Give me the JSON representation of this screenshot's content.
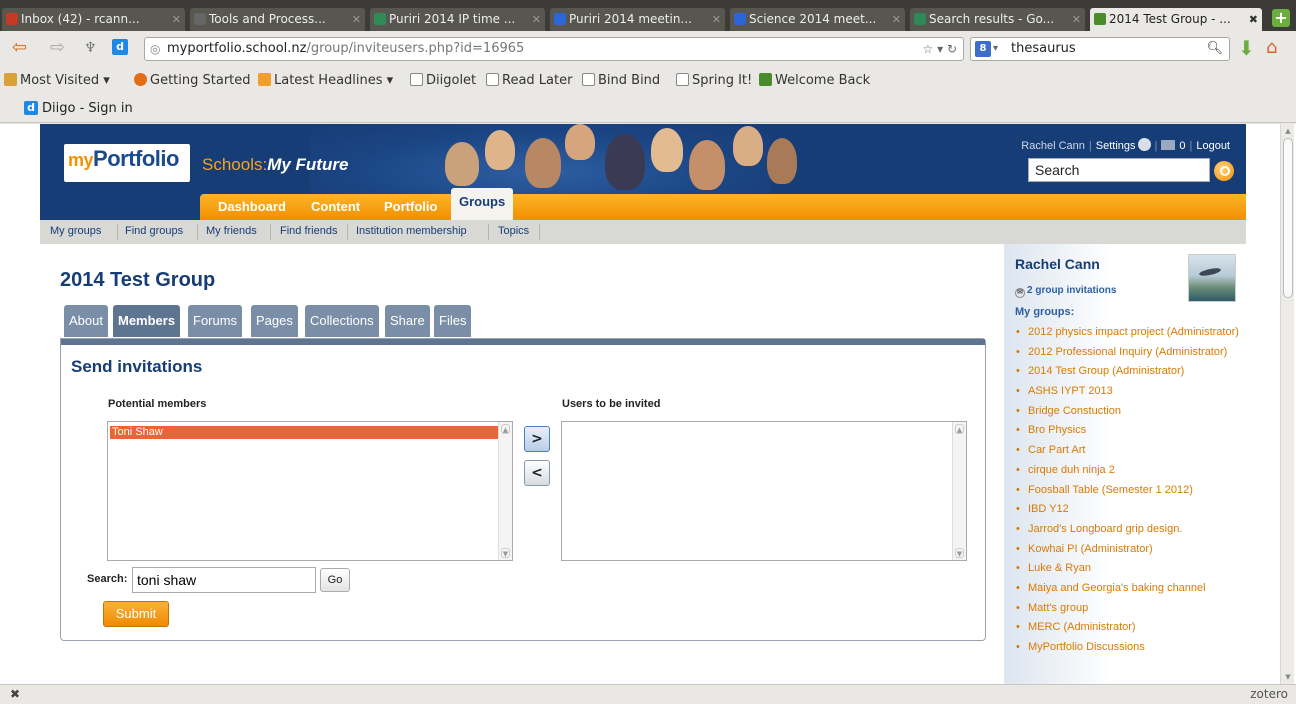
{
  "browser": {
    "tabs": [
      {
        "label": "Inbox (42) - rcann...",
        "color": "#c23b22"
      },
      {
        "label": "Tools and Process...",
        "color": "#666666"
      },
      {
        "label": "Puriri 2014 IP time ...",
        "color": "#2e8b57"
      },
      {
        "label": "Puriri 2014 meetin...",
        "color": "#2a66d9"
      },
      {
        "label": "Science 2014 meet...",
        "color": "#2a66d9"
      },
      {
        "label": "Search results - Go...",
        "color": "#2e8b57"
      },
      {
        "label": "2014 Test Group - ...",
        "color": "#4a8c2a"
      }
    ],
    "url_host": "myportfolio.school.nz",
    "url_path": "/group/inviteusers.php?id=16965",
    "search_engine_query": "thesaurus",
    "bookmarks": [
      "Most Visited ▾",
      "Getting Started",
      "Latest Headlines ▾",
      "Diigolet",
      "Read Later",
      "Bind Bind",
      "Spring It!",
      "Welcome Back"
    ],
    "diigo_label": "Diigo - Sign in",
    "status_right": "zotero"
  },
  "site": {
    "logo_my": "my",
    "logo_portfolio": "Portfolio",
    "tagline_a": "Schools:",
    "tagline_b": "My Future",
    "user_name": "Rachel Cann",
    "settings": "Settings",
    "inbox_count": "0",
    "logout": "Logout",
    "search_placeholder": "Search",
    "main_nav": [
      "Dashboard",
      "Content",
      "Portfolio",
      "Groups"
    ],
    "sub_nav": [
      "My groups",
      "Find groups",
      "My friends",
      "Find friends",
      "Institution membership",
      "Topics"
    ]
  },
  "group": {
    "title": "2014 Test Group",
    "tabs": [
      "About",
      "Members",
      "Forums",
      "Pages",
      "Collections",
      "Share",
      "Files"
    ],
    "panel_title": "Send invitations",
    "potential_label": "Potential members",
    "invited_label": "Users to be invited",
    "potential_members": [
      "Toni Shaw"
    ],
    "add_btn": ">",
    "remove_btn": "<",
    "search_label": "Search:",
    "search_value": "toni shaw",
    "go_label": "Go",
    "submit_label": "Submit"
  },
  "sidebar": {
    "name": "Rachel Cann",
    "invitations": "2 group invitations",
    "my_groups_label": "My groups:",
    "groups": [
      "2012 physics impact project (Administrator)",
      "2012 Professional Inquiry (Administrator)",
      "2014 Test Group (Administrator)",
      "ASHS IYPT 2013",
      "Bridge Constuction",
      "Bro Physics",
      "Car Part Art",
      "cirque duh ninja 2",
      "Foosball Table (Semester 1 2012)",
      "IBD Y12",
      "Jarrod's Longboard grip design.",
      "Kowhai PI (Administrator)",
      "Luke & Ryan",
      "Maiya and Georgia's baking channel",
      "Matt's group",
      "MERC (Administrator)",
      "MyPortfolio Discussions"
    ]
  }
}
